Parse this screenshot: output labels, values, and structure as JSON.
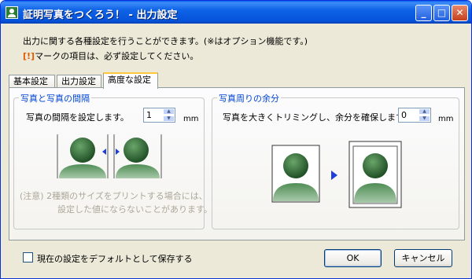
{
  "window": {
    "title": "証明写真をつくろう！ - 出力設定",
    "min_label": "_",
    "max_label": "□",
    "close_label": "✕"
  },
  "intro": {
    "line1": "出力に関する各種設定を行うことができます。(※はオプション機能です。)",
    "warn_mark": "[!]",
    "line2": "マークの項目は、必ず設定してください。"
  },
  "tabs": [
    {
      "label": "基本設定",
      "selected": false
    },
    {
      "label": "出力設定",
      "selected": false
    },
    {
      "label": "高度な設定",
      "selected": true
    }
  ],
  "group_spacing": {
    "title": "写真と写真の間隔",
    "label": "写真の間隔を設定します。",
    "value": "1",
    "unit": "mm",
    "note_line1": "(注意)  2種類のサイズをプリントする場合には、",
    "note_line2": "設定した値にならないことがあります。"
  },
  "group_margin": {
    "title": "写真周りの余分",
    "label": "写真を大きくトリミングし、余分を確保します。",
    "value": "0",
    "unit": "mm"
  },
  "footer": {
    "checkbox_label": "現在の設定をデフォルトとして保存する",
    "checkbox_checked": false,
    "ok_label": "OK",
    "cancel_label": "キャンセル"
  },
  "colors": {
    "title_bar": "#0553d9",
    "group_title": "#0046d5",
    "warn": "#e05a00",
    "note": "#aca899",
    "person": "#2e6b35",
    "arrow": "#1f3fd8"
  }
}
